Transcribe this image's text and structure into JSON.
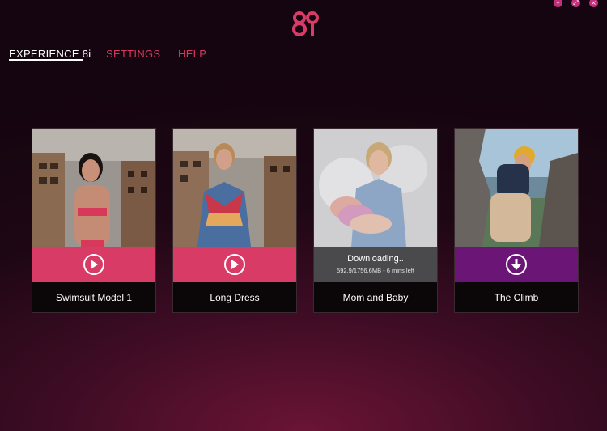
{
  "window": {
    "controls": [
      {
        "name": "minimize",
        "icon": "minus-icon",
        "glyph": "–"
      },
      {
        "name": "maximize",
        "icon": "expand-icon",
        "glyph": "⤢"
      },
      {
        "name": "close",
        "icon": "close-icon",
        "glyph": "×"
      }
    ]
  },
  "brand": {
    "logo_text": "8i",
    "accent": "#d93b67"
  },
  "nav": {
    "items": [
      {
        "label": "EXPERIENCE 8i",
        "active": true
      },
      {
        "label": "SETTINGS",
        "active": false
      },
      {
        "label": "HELP",
        "active": false
      }
    ]
  },
  "cards": [
    {
      "title": "Swimsuit Model 1",
      "action": "play",
      "action_icon": "play-icon",
      "action_color": "#d93b67"
    },
    {
      "title": "Long Dress",
      "action": "play",
      "action_icon": "play-icon",
      "action_color": "#d93b67"
    },
    {
      "title": "Mom and Baby",
      "action": "downloading",
      "status": "Downloading..",
      "progress_text": "592.9/1756.6MB - 6 mins left",
      "progress": 0.3375,
      "action_color": "#4a4a4c"
    },
    {
      "title": "The Climb",
      "action": "download",
      "action_icon": "download-icon",
      "action_color": "#6b1676"
    }
  ]
}
